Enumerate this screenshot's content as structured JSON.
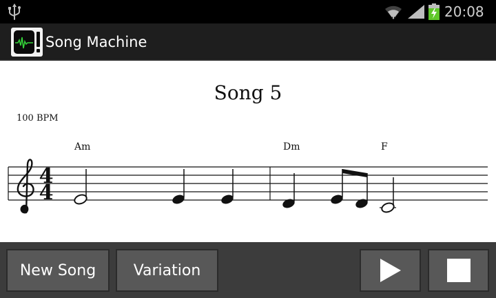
{
  "status_bar": {
    "time": "20:08",
    "icons": [
      "usb-icon",
      "wifi-icon",
      "signal-icon",
      "battery-charging-icon"
    ]
  },
  "action_bar": {
    "app_icon": "song-machine-app-icon",
    "title": "Song Machine"
  },
  "score": {
    "title": "Song 5",
    "tempo": "100 BPM",
    "time_signature": {
      "top": "4",
      "bottom": "4"
    },
    "chords": [
      "Am",
      "Dm",
      "F"
    ],
    "clef": "treble-clef-icon"
  },
  "controls": {
    "new_song_label": "New Song",
    "variation_label": "Variation",
    "play_icon": "play-icon",
    "stop_icon": "stop-icon"
  },
  "colors": {
    "status_bar_bg": "#000000",
    "action_bar_bg": "#1e1e1e",
    "controls_bg": "#3c3c3c",
    "button_bg": "#585858",
    "battery_green": "#5fc72a"
  }
}
